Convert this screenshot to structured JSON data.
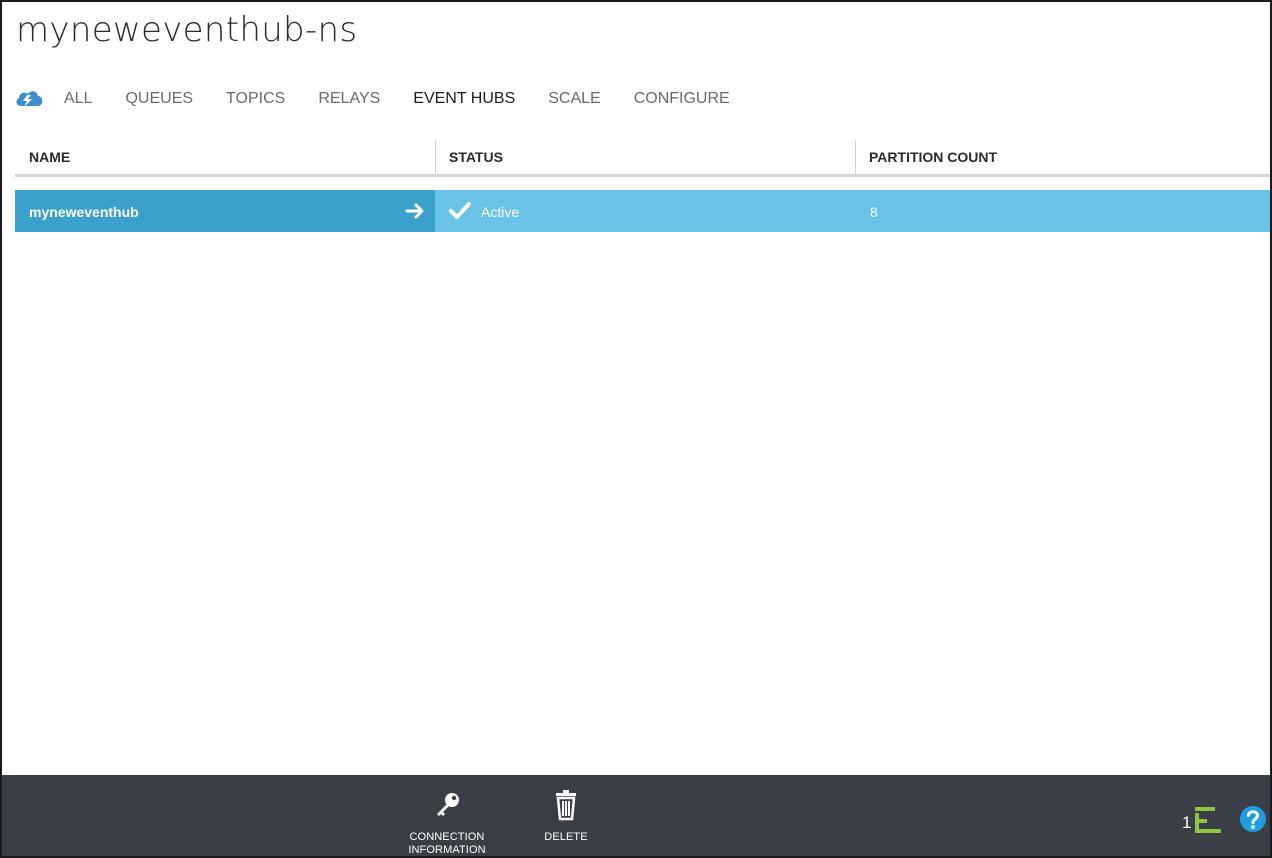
{
  "page": {
    "title": "myneweventhub-ns"
  },
  "nav": {
    "icon": "service-bus-cloud-icon",
    "tabs": [
      {
        "label": "ALL",
        "active": false
      },
      {
        "label": "QUEUES",
        "active": false
      },
      {
        "label": "TOPICS",
        "active": false
      },
      {
        "label": "RELAYS",
        "active": false
      },
      {
        "label": "EVENT HUBS",
        "active": true
      },
      {
        "label": "SCALE",
        "active": false
      },
      {
        "label": "CONFIGURE",
        "active": false
      }
    ]
  },
  "table": {
    "columns": [
      "NAME",
      "STATUS",
      "PARTITION COUNT"
    ],
    "rows": [
      {
        "name": "myneweventhub",
        "status": "Active",
        "partition_count": "8"
      }
    ]
  },
  "commandbar": {
    "commands": [
      {
        "label_line1": "CONNECTION",
        "label_line2": "INFORMATION",
        "icon": "key-icon"
      },
      {
        "label_line1": "DELETE",
        "label_line2": "",
        "icon": "trash-icon"
      }
    ],
    "status_count": "1"
  },
  "colors": {
    "row_selected": "#3aa0cc",
    "row_highlight": "#69c3e7",
    "commandbar_bg": "#3a3f47",
    "status_accent": "#8cc63f",
    "help_accent": "#1e9ee0"
  }
}
